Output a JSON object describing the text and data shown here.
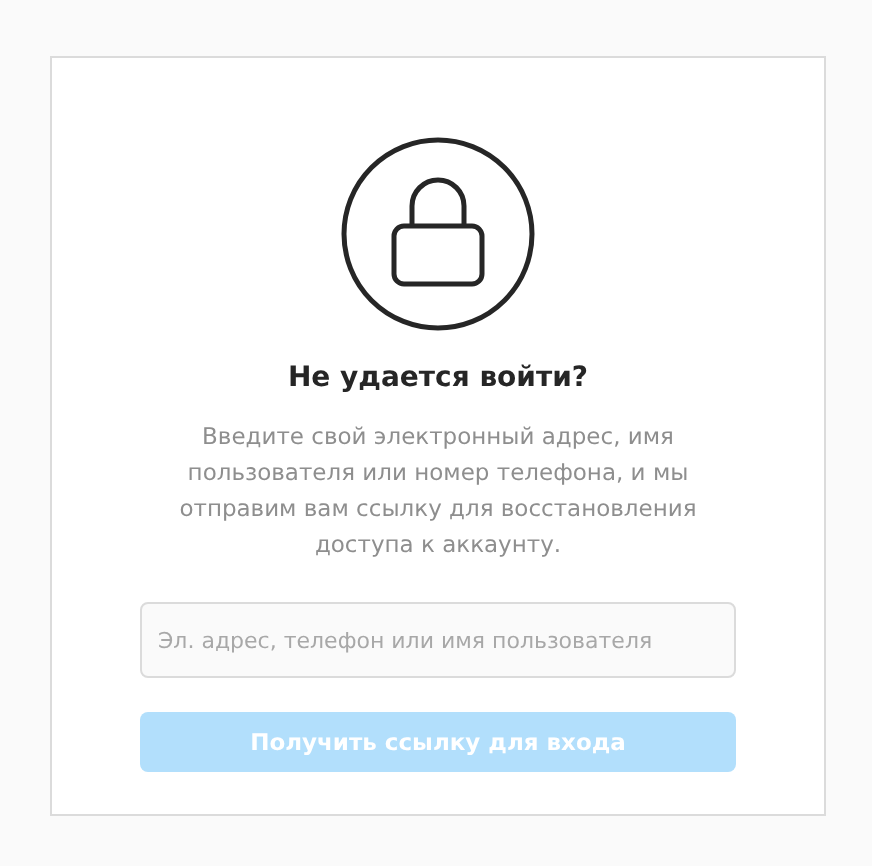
{
  "title": "Не удается войти?",
  "description": "Введите свой электронный адрес, имя пользователя или номер телефона, и мы отправим вам ссылку для восстановления доступа к аккаунту.",
  "login_field": {
    "placeholder": "Эл. адрес, телефон или имя пользователя"
  },
  "submit_button": {
    "label": "Получить ссылку для входа",
    "disabled": true
  }
}
